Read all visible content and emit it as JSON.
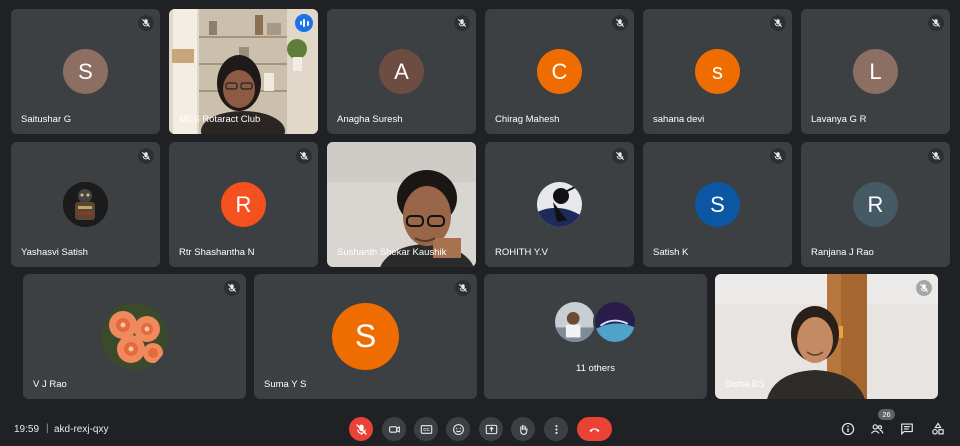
{
  "participants": [
    {
      "name": "Saitushar G",
      "initial": "S",
      "color": "#8d6e63"
    },
    {
      "name": "MES Rotaract Club",
      "type": "video"
    },
    {
      "name": "Anagha Suresh",
      "initial": "A",
      "color": "#6d4c41"
    },
    {
      "name": "Chirag Mahesh",
      "initial": "C",
      "color": "#ef6c00"
    },
    {
      "name": "sahana devi",
      "initial": "s",
      "color": "#ef6c00"
    },
    {
      "name": "Lavanya G R",
      "initial": "L",
      "color": "#8d6e63"
    },
    {
      "name": "Yashasvi Satish",
      "type": "photo"
    },
    {
      "name": "Rtr Shashantha N",
      "initial": "R",
      "color": "#f4511e"
    },
    {
      "name": "Sushanth Shekar Kaushik",
      "type": "video"
    },
    {
      "name": "ROHITH Y.V",
      "type": "photo"
    },
    {
      "name": "Satish K",
      "initial": "S",
      "color": "#0b57a3"
    },
    {
      "name": "Ranjana J Rao",
      "initial": "R",
      "color": "#455a64"
    },
    {
      "name": "V J Rao",
      "type": "photo"
    },
    {
      "name": "Suma Y S",
      "initial": "S",
      "color": "#ef6c00"
    },
    {
      "name": "11 others",
      "type": "group"
    },
    {
      "name": "Disha BS",
      "type": "video"
    }
  ],
  "toolbar": {
    "time": "19:59",
    "separator": "|",
    "meeting_code": "akd-rexj-qxy",
    "participant_count": "26",
    "cc_label": "CC"
  },
  "colors": {
    "background": "#202124",
    "tile": "#3c4043",
    "accent": "#8ab4f8",
    "leave": "#ea4335"
  }
}
